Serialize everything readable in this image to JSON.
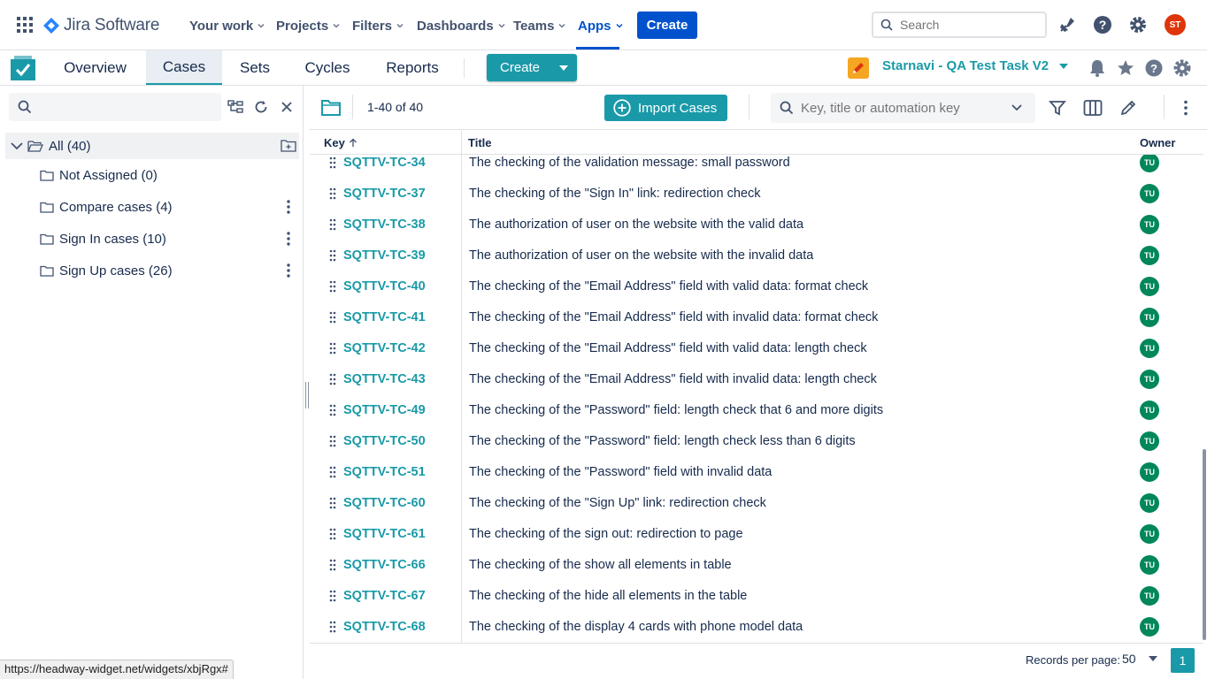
{
  "topnav": {
    "brand": "Jira Software",
    "items": [
      {
        "label": "Your work"
      },
      {
        "label": "Projects"
      },
      {
        "label": "Filters"
      },
      {
        "label": "Dashboards"
      },
      {
        "label": "Teams"
      },
      {
        "label": "Apps"
      }
    ],
    "create_label": "Create",
    "search_placeholder": "Search",
    "avatar_initials": "ST",
    "accent": "#0052cc"
  },
  "app": {
    "tabs": [
      {
        "label": "Overview"
      },
      {
        "label": "Cases"
      },
      {
        "label": "Sets"
      },
      {
        "label": "Cycles"
      },
      {
        "label": "Reports"
      }
    ],
    "create_label": "Create",
    "project_name": "Starnavi - QA Test Task V2",
    "accent": "#1a9aa8"
  },
  "tree": {
    "search_value": "",
    "all_label": "All (40)",
    "folders": [
      {
        "label": "Not Assigned (0)"
      },
      {
        "label": "Compare cases (4)"
      },
      {
        "label": "Sign In cases (10)"
      },
      {
        "label": "Sign Up cases (26)"
      }
    ]
  },
  "toolbar": {
    "range": "1-40 of 40",
    "import_label": "Import Cases",
    "search_placeholder": "Key, title or automation key"
  },
  "table": {
    "headers": {
      "key": "Key",
      "title": "Title",
      "owner": "Owner"
    },
    "rows": [
      {
        "key": "SQTTV-TC-34",
        "title": "The checking of the validation message: small password",
        "owner": "TU"
      },
      {
        "key": "SQTTV-TC-37",
        "title": "The checking of the \"Sign In\" link: redirection check",
        "owner": "TU"
      },
      {
        "key": "SQTTV-TC-38",
        "title": "The authorization of user on the website with the valid data",
        "owner": "TU"
      },
      {
        "key": "SQTTV-TC-39",
        "title": "The authorization of user on the website with the invalid data",
        "owner": "TU"
      },
      {
        "key": "SQTTV-TC-40",
        "title": "The checking of the \"Email Address\" field with valid data: format check",
        "owner": "TU"
      },
      {
        "key": "SQTTV-TC-41",
        "title": "The checking of the \"Email Address\" field with invalid data: format check",
        "owner": "TU"
      },
      {
        "key": "SQTTV-TC-42",
        "title": "The checking of the \"Email Address\" field with valid data: length check",
        "owner": "TU"
      },
      {
        "key": "SQTTV-TC-43",
        "title": "The checking of the \"Email Address\" field with invalid data: length check",
        "owner": "TU"
      },
      {
        "key": "SQTTV-TC-49",
        "title": "The checking of the \"Password\" field: length check that 6 and more digits",
        "owner": "TU"
      },
      {
        "key": "SQTTV-TC-50",
        "title": "The checking of the \"Password\" field: length check less than 6 digits",
        "owner": "TU"
      },
      {
        "key": "SQTTV-TC-51",
        "title": "The checking of the \"Password\" field with invalid data",
        "owner": "TU"
      },
      {
        "key": "SQTTV-TC-60",
        "title": "The checking of the \"Sign Up\" link: redirection check",
        "owner": "TU"
      },
      {
        "key": "SQTTV-TC-61",
        "title": "The checking of the sign out: redirection to page",
        "owner": "TU"
      },
      {
        "key": "SQTTV-TC-66",
        "title": "The checking of the show all elements in table",
        "owner": "TU"
      },
      {
        "key": "SQTTV-TC-67",
        "title": "The checking of the hide all elements in the table",
        "owner": "TU"
      },
      {
        "key": "SQTTV-TC-68",
        "title": "The checking of the display 4 cards with phone model data",
        "owner": "TU"
      }
    ]
  },
  "footer": {
    "records_per_page_label": "Records per page:",
    "records_per_page_value": "50",
    "current_page": "1"
  },
  "status_bar_url": "https://headway-widget.net/widgets/xbjRgx#"
}
